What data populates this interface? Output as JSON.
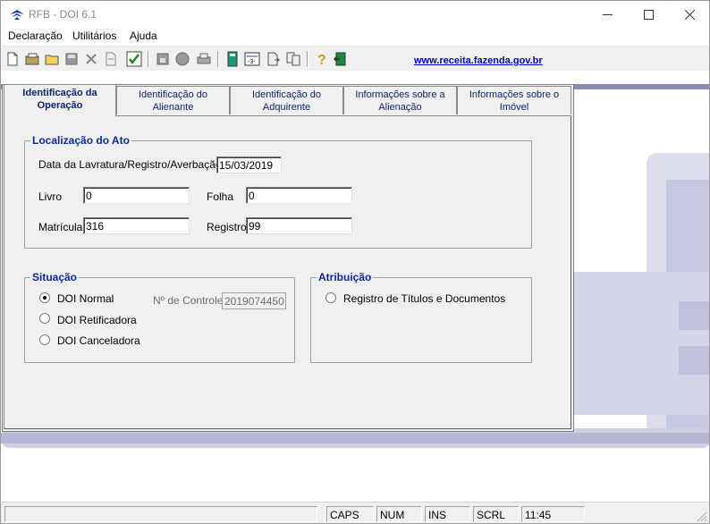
{
  "window": {
    "title": "RFB - DOI 6.1"
  },
  "menu": [
    "Declaração",
    "Utilitários",
    "Ajuda"
  ],
  "toolbar": {
    "link": "www.receita.fazenda.gov.br",
    "icons": [
      "new-icon",
      "open-icon",
      "folder-icon",
      "save-icon",
      "delete-icon",
      "import-icon",
      "validate-icon",
      "floppy-icon",
      "disk-icon",
      "print-icon",
      "calculator-icon",
      "form-icon",
      "export-icon",
      "copy-icon",
      "help-icon",
      "exit-icon"
    ]
  },
  "tabs": [
    {
      "label": "Identificação da Operação",
      "active": true
    },
    {
      "label": "Identificação do Alienante",
      "active": false
    },
    {
      "label": "Identificação do Adquirente",
      "active": false
    },
    {
      "label": "Informações sobre a Alienação",
      "active": false
    },
    {
      "label": "Informações sobre o Imóvel",
      "active": false
    }
  ],
  "localizacao": {
    "title": "Localização do Ato",
    "data_label": "Data da Lavratura/Registro/Averbação:",
    "data_value": "15/03/2019",
    "livro_label": "Livro",
    "livro_value": "0",
    "folha_label": "Folha",
    "folha_value": "0",
    "matricula_label": "Matrícula",
    "matricula_value": "316",
    "registro_label": "Registro",
    "registro_value": "99"
  },
  "situacao": {
    "title": "Situação",
    "options": [
      {
        "label": "DOI Normal",
        "checked": true
      },
      {
        "label": "DOI Retificadora",
        "checked": false
      },
      {
        "label": "DOI Canceladora",
        "checked": false
      }
    ],
    "controle_label": "Nº de Controle",
    "controle_value": "2019074450"
  },
  "atribuicao": {
    "title": "Atribuição",
    "options": [
      {
        "label": "Registro de Títulos e Documentos",
        "checked": false
      }
    ]
  },
  "statusbar": {
    "caps": "CAPS",
    "num": "NUM",
    "ins": "INS",
    "scrl": "SCRL",
    "time": "11:45"
  },
  "colors": {
    "accent": "#0a2a9a",
    "link": "#0000c0",
    "mdi_shape": "#dcdcec"
  }
}
